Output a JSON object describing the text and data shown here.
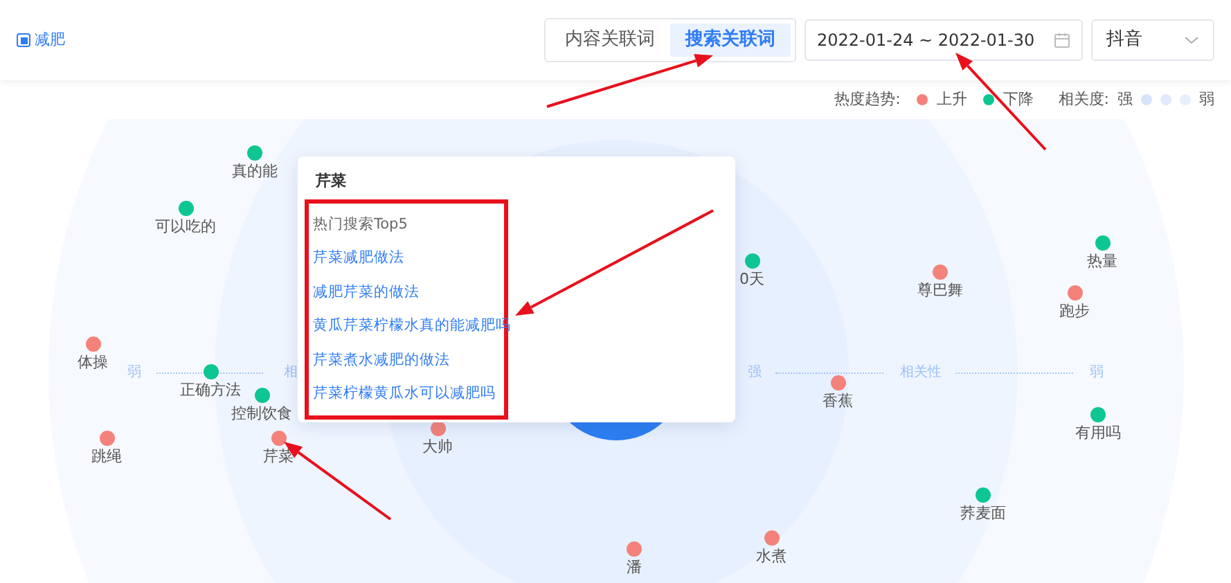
{
  "header": {
    "keyword": "减肥",
    "tabs": [
      {
        "label": "内容关联词",
        "selected": false
      },
      {
        "label": "搜索关联词",
        "selected": true
      }
    ],
    "date_range": "2022-01-24 ~ 2022-01-30",
    "platform": "抖音"
  },
  "legend": {
    "trend_label": "热度趋势:",
    "rising": "上升",
    "falling": "下降",
    "relevance_label": "相关度:",
    "strong": "强",
    "weak": "弱"
  },
  "axis": {
    "left_weak": "弱",
    "left_partial": "相",
    "strong": "强",
    "relevance": "相关性",
    "right_weak": "弱"
  },
  "nodes": [
    {
      "label": "真的能",
      "color": "#0dc693"
    },
    {
      "label": "可以吃的",
      "color": "#0dc693"
    },
    {
      "label": "体操",
      "color": "#f4827a"
    },
    {
      "label": "正确方法",
      "color": "#0dc693"
    },
    {
      "label": "控制饮食",
      "color": "#0dc693"
    },
    {
      "label": "跳绳",
      "color": "#f4827a"
    },
    {
      "label": "芹菜",
      "color": "#f4827a"
    },
    {
      "label": "大帅",
      "color": "#f4827a"
    },
    {
      "label": "0天",
      "color": "#0dc693"
    },
    {
      "label": "尊巴舞",
      "color": "#f4827a"
    },
    {
      "label": "热量",
      "color": "#0dc693"
    },
    {
      "label": "跑步",
      "color": "#f4827a"
    },
    {
      "label": "香蕉",
      "color": "#f4827a"
    },
    {
      "label": "有用吗",
      "color": "#0dc693"
    },
    {
      "label": "荞麦面",
      "color": "#0dc693"
    },
    {
      "label": "潘",
      "color": "#f4827a"
    },
    {
      "label": "水煮",
      "color": "#f4827a"
    }
  ],
  "popup": {
    "title": "芹菜",
    "subtitle": "热门搜索Top5",
    "items": [
      "芹菜减肥做法",
      "减肥芹菜的做法",
      "黄瓜芹菜柠檬水真的能减肥吗",
      "芹菜煮水减肥的做法",
      "芹菜柠檬黄瓜水可以减肥吗"
    ]
  }
}
